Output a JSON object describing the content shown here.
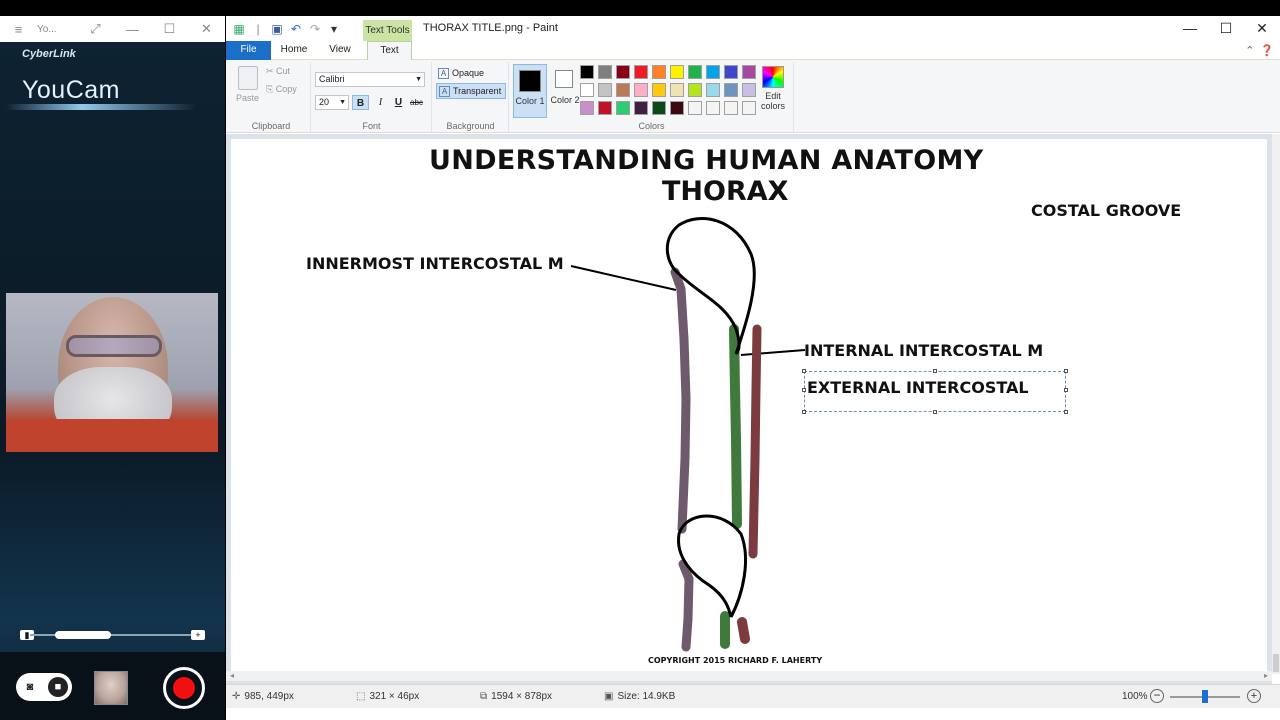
{
  "youcam": {
    "titlebar_title": "Yo...",
    "logo_small": "CyberLink",
    "logo": "YouCam"
  },
  "paint": {
    "title": "THORAX TITLE.png - Paint",
    "contextual_tab": "Text Tools",
    "tabs": [
      {
        "label": "File"
      },
      {
        "label": "Home"
      },
      {
        "label": "View"
      },
      {
        "label": "Text"
      }
    ],
    "clipboard": {
      "paste": "Paste",
      "cut": "Cut",
      "copy": "Copy",
      "label": "Clipboard"
    },
    "font": {
      "name": "Calibri",
      "size": "20",
      "bold": "B",
      "italic": "I",
      "underline": "U",
      "strike": "abc",
      "label": "Font"
    },
    "background": {
      "opaque": "Opaque",
      "transparent": "Transparent",
      "label": "Background"
    },
    "colors": {
      "color1": "Color 1",
      "color2": "Color 2",
      "edit": "Edit colors",
      "label": "Colors",
      "color1_value": "#000000",
      "color2_value": "#ffffff",
      "palette": [
        "#000000",
        "#7f7f7f",
        "#880015",
        "#ed1c24",
        "#ff7f27",
        "#fff200",
        "#22b14c",
        "#00a2e8",
        "#3f48cc",
        "#a349a4",
        "#ffffff",
        "#c3c3c3",
        "#b97a57",
        "#ffaec9",
        "#ffc90e",
        "#efe4b0",
        "#b5e61d",
        "#99d9ea",
        "#7092be",
        "#c8bfe7",
        "#c890c8",
        "#c0102a",
        "#2ecc71",
        "#402040",
        "#0a4a1a",
        "#3a0a10",
        "#f4f4f4",
        "#f4f4f4",
        "#f4f4f4",
        "#f4f4f4"
      ]
    },
    "canvas": {
      "title_line1": "UNDERSTANDING HUMAN ANATOMY",
      "title_line2": "THORAX",
      "costal_groove": "COSTAL GROOVE",
      "innermost": "INNERMOST INTERCOSTAL M",
      "internal": "INTERNAL INTERCOSTAL M",
      "external": "EXTERNAL INTERCOSTAL",
      "copyright": "COPYRIGHT 2015 RICHARD F. LAHERTY",
      "muscle_colors": {
        "innermost": "#6e5a6c",
        "internal": "#3f7a3c",
        "external": "#7b3b3f"
      }
    },
    "status": {
      "cursor": "985, 449px",
      "selection": "321 × 46px",
      "image_size": "1594 × 878px",
      "file_size": "Size: 14.9KB",
      "zoom": "100%"
    }
  }
}
